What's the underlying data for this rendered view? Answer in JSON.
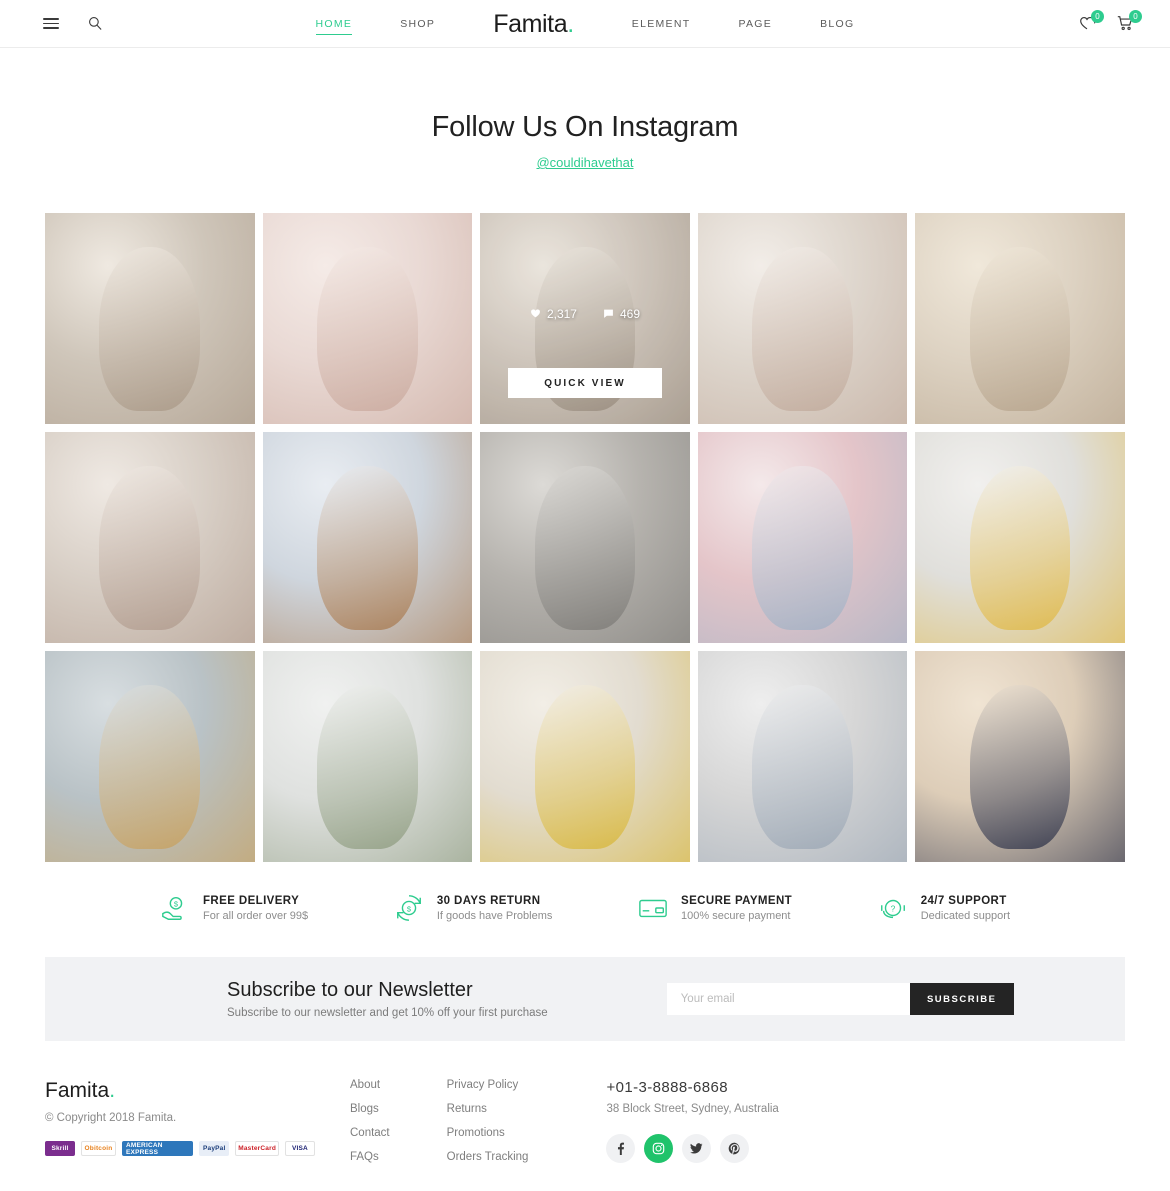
{
  "header": {
    "menu_icon": "hamburger-icon",
    "search_icon": "search-icon",
    "brand": "Famita",
    "brand_dot": ".",
    "nav_left": [
      {
        "label": "HOME",
        "active": true
      },
      {
        "label": "SHOP",
        "active": false
      }
    ],
    "nav_right": [
      {
        "label": "ELEMENT"
      },
      {
        "label": "PAGE"
      },
      {
        "label": "BLOG"
      }
    ],
    "wishlist": {
      "icon": "heart-icon",
      "count": "0"
    },
    "cart": {
      "icon": "cart-icon",
      "count": "0"
    }
  },
  "instagram": {
    "title": "Follow Us On Instagram",
    "handle": "@couldihavethat",
    "hover_cell_index": 2,
    "likes": "2,317",
    "comments": "469",
    "quick_view": "QUICK VIEW",
    "cells": [
      {
        "alt": "woman-white-sweater-on-bed",
        "c1": "#cfc6ba",
        "c2": "#efe9e1",
        "c3": "#a99886"
      },
      {
        "alt": "woman-pink-jacket-standing",
        "c1": "#e9d9d4",
        "c2": "#f5ebe7",
        "c3": "#c9a89c"
      },
      {
        "alt": "woman-white-lace-top-kitchen",
        "c1": "#c9bfb4",
        "c2": "#e8e2d9",
        "c3": "#8c7e6e"
      },
      {
        "alt": "pink-heeled-boots-pleated-skirt",
        "c1": "#ded6cd",
        "c2": "#f2ede8",
        "c3": "#c0a99a"
      },
      {
        "alt": "woman-sunglasses-white-brick-wall",
        "c1": "#ddd2c2",
        "c2": "#f0e8da",
        "c3": "#b5a28a"
      },
      {
        "alt": "woman-coffee-magazine-flatlay",
        "c1": "#d8cfc6",
        "c2": "#efe9e3",
        "c3": "#b09a8c"
      },
      {
        "alt": "flatlay-jeans-brown-top-sneakers",
        "c1": "#cfd6de",
        "c2": "#e9edf2",
        "c3": "#a8794e"
      },
      {
        "alt": "woman-crosswalk-street-style",
        "c1": "#b6b3ae",
        "c2": "#dcdad6",
        "c3": "#7c7a76"
      },
      {
        "alt": "woman-pink-sweater-white-sneakers",
        "c1": "#e4c5c9",
        "c2": "#f4e9ea",
        "c3": "#9fb0c4"
      },
      {
        "alt": "woman-yellow-blouse-navy-skirt",
        "c1": "#e0dfdb",
        "c2": "#f1f0ee",
        "c3": "#e0b740"
      },
      {
        "alt": "gold-sneakers-mosaic-tiles",
        "c1": "#b9c2c6",
        "c2": "#d8dee1",
        "c3": "#c8a05c"
      },
      {
        "alt": "woman-striped-shirt-green-pants",
        "c1": "#dfe1df",
        "c2": "#f0f1f0",
        "c3": "#8d9b7e"
      },
      {
        "alt": "woman-white-top-yellow-pants-stool",
        "c1": "#e2dcd0",
        "c2": "#f2eee6",
        "c3": "#d8b636"
      },
      {
        "alt": "flatlay-denim-shorts-tshirt-sneakers",
        "c1": "#d6d6d6",
        "c2": "#eeeeee",
        "c3": "#9aa6b4"
      },
      {
        "alt": "two-women-navy-black-jumpsuits",
        "c1": "#ddcdb8",
        "c2": "#f0e4d3",
        "c3": "#2b3047"
      }
    ]
  },
  "features": [
    {
      "icon": "hand-dollar-icon",
      "title": "FREE DELIVERY",
      "sub": "For all order over 99$"
    },
    {
      "icon": "refresh-dollar-icon",
      "title": "30 DAYS RETURN",
      "sub": "If goods have Problems"
    },
    {
      "icon": "credit-card-icon",
      "title": "SECURE PAYMENT",
      "sub": "100% secure payment"
    },
    {
      "icon": "headset-question-icon",
      "title": "24/7 SUPPORT",
      "sub": "Dedicated support"
    }
  ],
  "newsletter": {
    "title": "Subscribe to our Newsletter",
    "subtitle": "Subscribe to our newsletter and get 10% off your first purchase",
    "placeholder": "Your email",
    "value": "",
    "button": "SUBSCRIBE"
  },
  "footer": {
    "brand": "Famita",
    "brand_dot": ".",
    "copyright": "© Copyright 2018 Famita.",
    "payments": [
      {
        "name": "Skrill",
        "label": "Skrill",
        "bg": "#7b2d8e",
        "fg": "#ffffff"
      },
      {
        "name": "Bitcoin",
        "label": "Obitcoin",
        "bg": "#ffffff",
        "fg": "#e8821e"
      },
      {
        "name": "American Express",
        "label": "AMERICAN EXPRESS",
        "bg": "#2e77bb",
        "fg": "#ffffff"
      },
      {
        "name": "PayPal",
        "label": "PayPal",
        "bg": "#e8eef7",
        "fg": "#1b3d7a"
      },
      {
        "name": "Mastercard",
        "label": "MasterCard",
        "bg": "#ffffff",
        "fg": "#cc2027"
      },
      {
        "name": "Visa",
        "label": "VISA",
        "bg": "#ffffff",
        "fg": "#1a1f71"
      }
    ],
    "links_col1": [
      "About",
      "Blogs",
      "Contact",
      "FAQs"
    ],
    "links_col2": [
      "Privacy Policy",
      "Returns",
      "Promotions",
      "Orders Tracking"
    ],
    "phone": "+01-3-8888-6868",
    "address": "38 Block Street, Sydney, Australia",
    "socials": [
      {
        "name": "facebook-icon",
        "glyph": "f",
        "active": false
      },
      {
        "name": "instagram-icon",
        "glyph": "◉",
        "active": true
      },
      {
        "name": "twitter-icon",
        "glyph": "🐦",
        "active": false
      },
      {
        "name": "pinterest-icon",
        "glyph": "℗",
        "active": false
      }
    ]
  },
  "colors": {
    "accent": "#2ecc8f",
    "dark": "#242424",
    "band": "#f1f2f4"
  }
}
